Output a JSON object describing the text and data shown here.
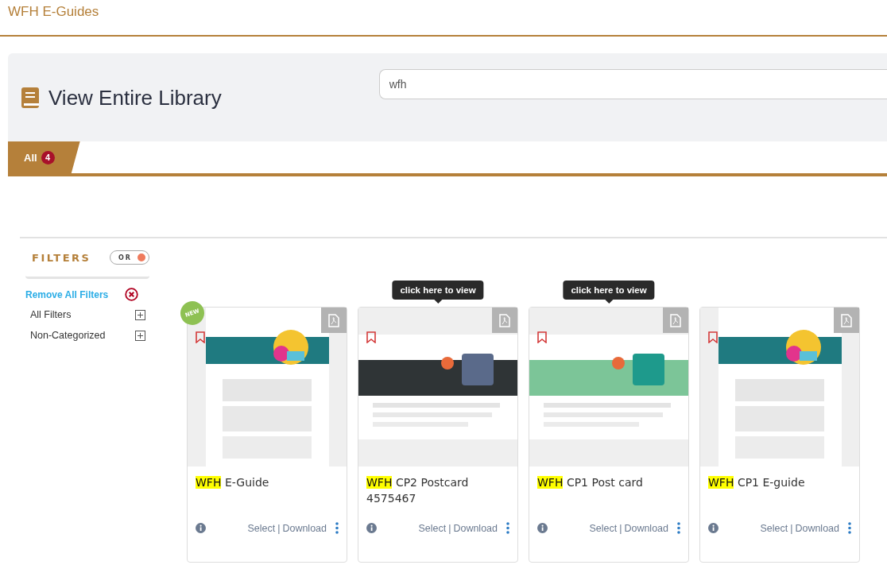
{
  "header": {
    "title": "WFH E-Guides"
  },
  "library": {
    "title": "View Entire Library",
    "search": {
      "value": "wfh"
    }
  },
  "tabs": [
    {
      "label": "All",
      "count": "4",
      "selected": true
    }
  ],
  "filters": {
    "title": "FILTERS",
    "mode": {
      "label": "OR",
      "on": true
    },
    "remove_all": "Remove All Filters",
    "groups": [
      {
        "label": "All Filters",
        "expanded": false
      },
      {
        "label": "Non-Categorized",
        "expanded": false
      }
    ]
  },
  "cards": [
    {
      "highlight": "WFH",
      "title": "E-Guide",
      "badge": "NEW",
      "bookmarked": false,
      "thumbnail": {
        "kind": "picture"
      },
      "actions": [
        "Select",
        "|",
        "Download"
      ]
    },
    {
      "highlight": "WFH",
      "title": "CP2 Postcard 4575467",
      "tooltip": "click here to view",
      "bookmarked": false,
      "thumbnail": {
        "kind": "picture"
      },
      "actions": [
        "Select",
        "|",
        "Download"
      ]
    },
    {
      "highlight": "WFH",
      "title": "CP1 Post card",
      "tooltip": "click here to view",
      "bookmarked": false,
      "thumbnail": {
        "kind": "picture"
      },
      "actions": [
        "Select",
        "|",
        "Download"
      ]
    },
    {
      "highlight": "WFH",
      "title": "CP1 E-guide",
      "bookmarked": false,
      "thumbnail": {
        "kind": "picture"
      },
      "actions": [
        "Select",
        "|",
        "Download"
      ]
    }
  ]
}
